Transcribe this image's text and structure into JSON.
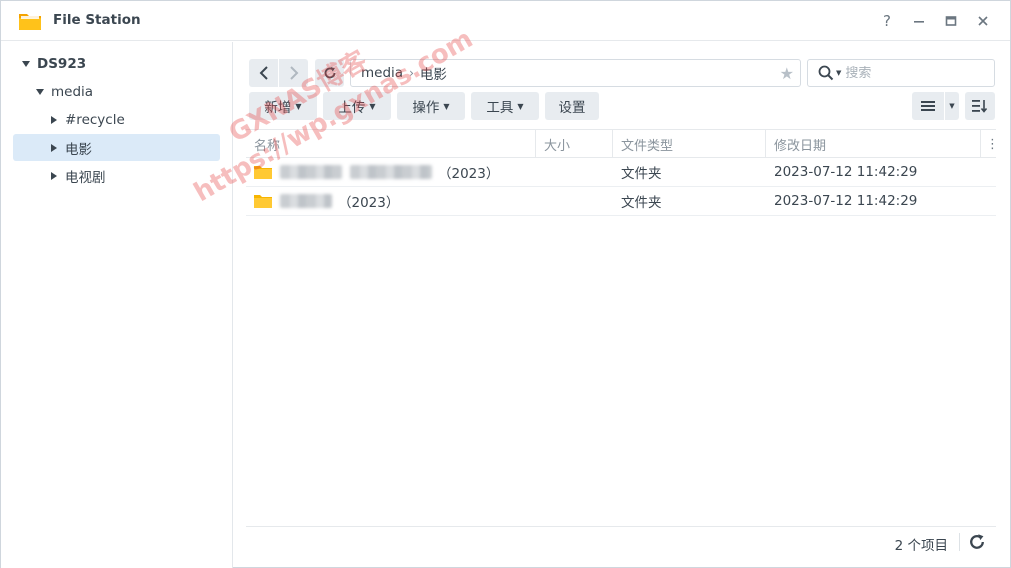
{
  "window": {
    "title": "File Station",
    "controls": [
      "?",
      "—",
      "□",
      "✕"
    ]
  },
  "sidebar": {
    "root": "DS923",
    "share": "media",
    "folders": [
      "#recycle",
      "电影",
      "电视剧"
    ],
    "selected": "电影"
  },
  "toolbar": {
    "path": [
      "media",
      "电影"
    ],
    "search_placeholder": "搜索",
    "buttons": {
      "create": "新增",
      "upload": "上传",
      "action": "操作",
      "tools": "工具",
      "settings": "设置"
    }
  },
  "table": {
    "columns": [
      "名称",
      "大小",
      "文件类型",
      "修改日期"
    ],
    "rows": [
      {
        "name_suffix": "（2023）",
        "size": "",
        "type": "文件夹",
        "modified": "2023-07-12 11:42:29"
      },
      {
        "name_suffix": "（2023）",
        "size": "",
        "type": "文件夹",
        "modified": "2023-07-12 11:42:29"
      }
    ]
  },
  "footer": {
    "count": "2 个项目"
  },
  "watermark": {
    "line1": "GXNAS博客",
    "line2": "https://wp.gxnas.com"
  },
  "colors": {
    "accent": "#0086e5",
    "selected_bg": "#dbeaf8",
    "folder": "#f7b500",
    "watermark": "#e64646"
  }
}
